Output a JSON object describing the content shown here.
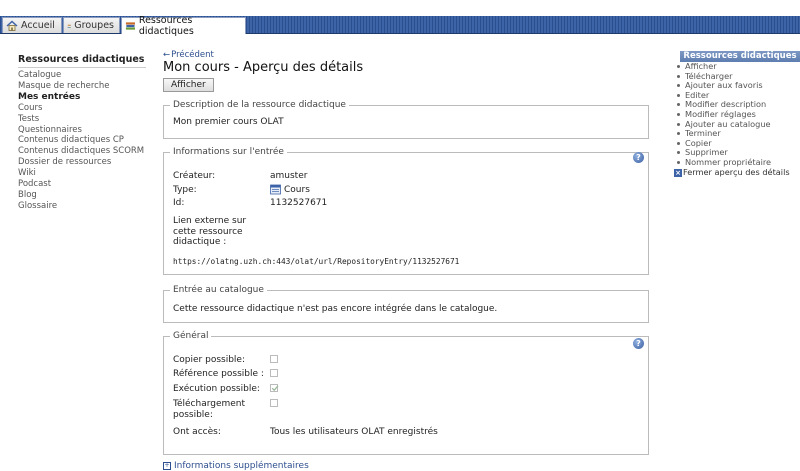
{
  "tabs": [
    {
      "label": "Accueil",
      "icon": "home-icon"
    },
    {
      "label": "Groupes",
      "icon": "groups-icon"
    },
    {
      "label": "Ressources didactiques",
      "icon": "resources-icon"
    }
  ],
  "leftnav": {
    "header": "Ressources didactiques",
    "items_top": [
      "Catalogue",
      "Masque de recherche"
    ],
    "section": "Mes entrées",
    "items": [
      "Cours",
      "Tests",
      "Questionnaires",
      "Contenus didactiques CP",
      "Contenus didactiques SCORM",
      "Dossier de ressources",
      "Wiki",
      "Podcast",
      "Blog",
      "Glossaire"
    ]
  },
  "main": {
    "prev_link": "Précédent",
    "title": "Mon cours - Aperçu des détails",
    "afficher_button": "Afficher",
    "description": {
      "legend": "Description de la ressource didactique",
      "text": "Mon premier cours OLAT"
    },
    "info": {
      "legend": "Informations sur l'entrée",
      "creator_label": "Créateur:",
      "creator_value": "amuster",
      "type_label": "Type:",
      "type_value": "Cours",
      "id_label": "Id:",
      "id_value": "1132527671",
      "link_label": "Lien externe sur cette ressource didactique :",
      "link_url": "https://olatng.uzh.ch:443/olat/url/RepositoryEntry/1132527671"
    },
    "catalog": {
      "legend": "Entrée au catalogue",
      "text": "Cette ressource didactique n'est pas encore intégrée dans le catalogue."
    },
    "general": {
      "legend": "Général",
      "copy_label": "Copier possible:",
      "copy_checked": false,
      "reference_label": "Référence possible :",
      "reference_checked": false,
      "execution_label": "Exécution possible:",
      "execution_checked": true,
      "download_label": "Téléchargement possible:",
      "download_checked": false,
      "access_label": "Ont accès:",
      "access_value": "Tous les utilisateurs OLAT enregistrés"
    },
    "more_info": "Informations supplémentaires"
  },
  "rightpanel": {
    "header": "Ressources didactiques",
    "items": [
      "Afficher",
      "Télécharger",
      "Ajouter aux favoris",
      "Editer",
      "Modifier description",
      "Modifier réglages",
      "Ajouter au catalogue",
      "Terminer",
      "Copier",
      "Supprimer",
      "Nommer propriétaire"
    ],
    "close": "Fermer aperçu des détails"
  },
  "colors": {
    "accent": "#2d4f8f",
    "tabbar": "#3d64a6",
    "panel_header": "#6a87b9"
  }
}
